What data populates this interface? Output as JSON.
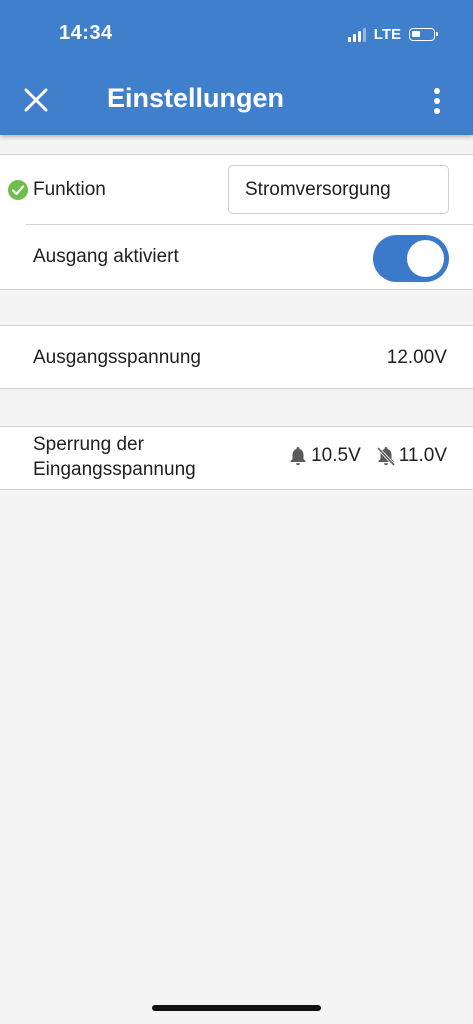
{
  "status_bar": {
    "time": "14:34",
    "network": "LTE",
    "signal_icon": "signal-bars-icon",
    "battery_icon": "battery-icon"
  },
  "header": {
    "title": "Einstellungen",
    "close_icon": "close-icon",
    "menu_icon": "more-vertical-icon"
  },
  "settings": {
    "funktion": {
      "label": "Funktion",
      "value": "Stromversorgung",
      "status_icon": "check-circle-icon",
      "status_color": "#6cc04a"
    },
    "ausgang": {
      "label": "Ausgang aktiviert",
      "enabled": true
    },
    "ausgangsspannung": {
      "label": "Ausgangsspannung",
      "value": "12.00V"
    },
    "sperrung": {
      "label_line1": "Sperrung der",
      "label_line2": "Eingangsspannung",
      "alarm_value": "10.5V",
      "clear_value": "11.0V",
      "alarm_icon": "bell-icon",
      "clear_icon": "bell-off-icon"
    }
  },
  "colors": {
    "primary": "#3f7fcb",
    "toggle": "#3b7acb",
    "background": "#f4f4f4"
  }
}
